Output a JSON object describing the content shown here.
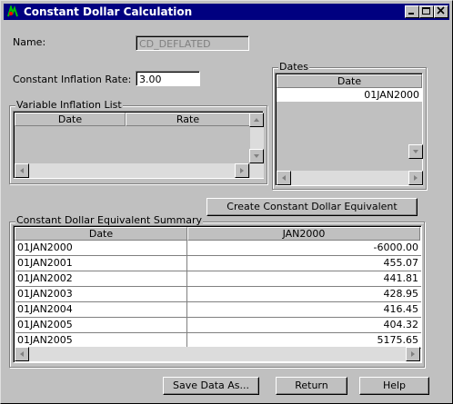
{
  "window": {
    "title": "Constant Dollar Calculation",
    "controls": [
      "minimize-icon",
      "maximize-icon",
      "close-icon"
    ]
  },
  "form": {
    "name_label": "Name:",
    "name_value": "CD_DEFLATED",
    "rate_label": "Constant Inflation Rate:",
    "rate_value": "3.00"
  },
  "variable_list": {
    "title": "Variable Inflation List",
    "columns": [
      "Date",
      "Rate"
    ]
  },
  "dates": {
    "title": "Dates",
    "column": "Date",
    "items": [
      "01JAN2000"
    ]
  },
  "create_button": "Create Constant Dollar Equivalent",
  "summary": {
    "title": "Constant Dollar Equivalent Summary",
    "columns": [
      "Date",
      "JAN2000"
    ],
    "rows": [
      {
        "date": "01JAN2000",
        "value": "-6000.00"
      },
      {
        "date": "01JAN2001",
        "value": "455.07"
      },
      {
        "date": "01JAN2002",
        "value": "441.81"
      },
      {
        "date": "01JAN2003",
        "value": "428.95"
      },
      {
        "date": "01JAN2004",
        "value": "416.45"
      },
      {
        "date": "01JAN2005",
        "value": "404.32"
      },
      {
        "date": "01JAN2005",
        "value": "5175.65"
      }
    ]
  },
  "buttons": {
    "save": "Save Data As...",
    "return": "Return",
    "help": "Help"
  }
}
